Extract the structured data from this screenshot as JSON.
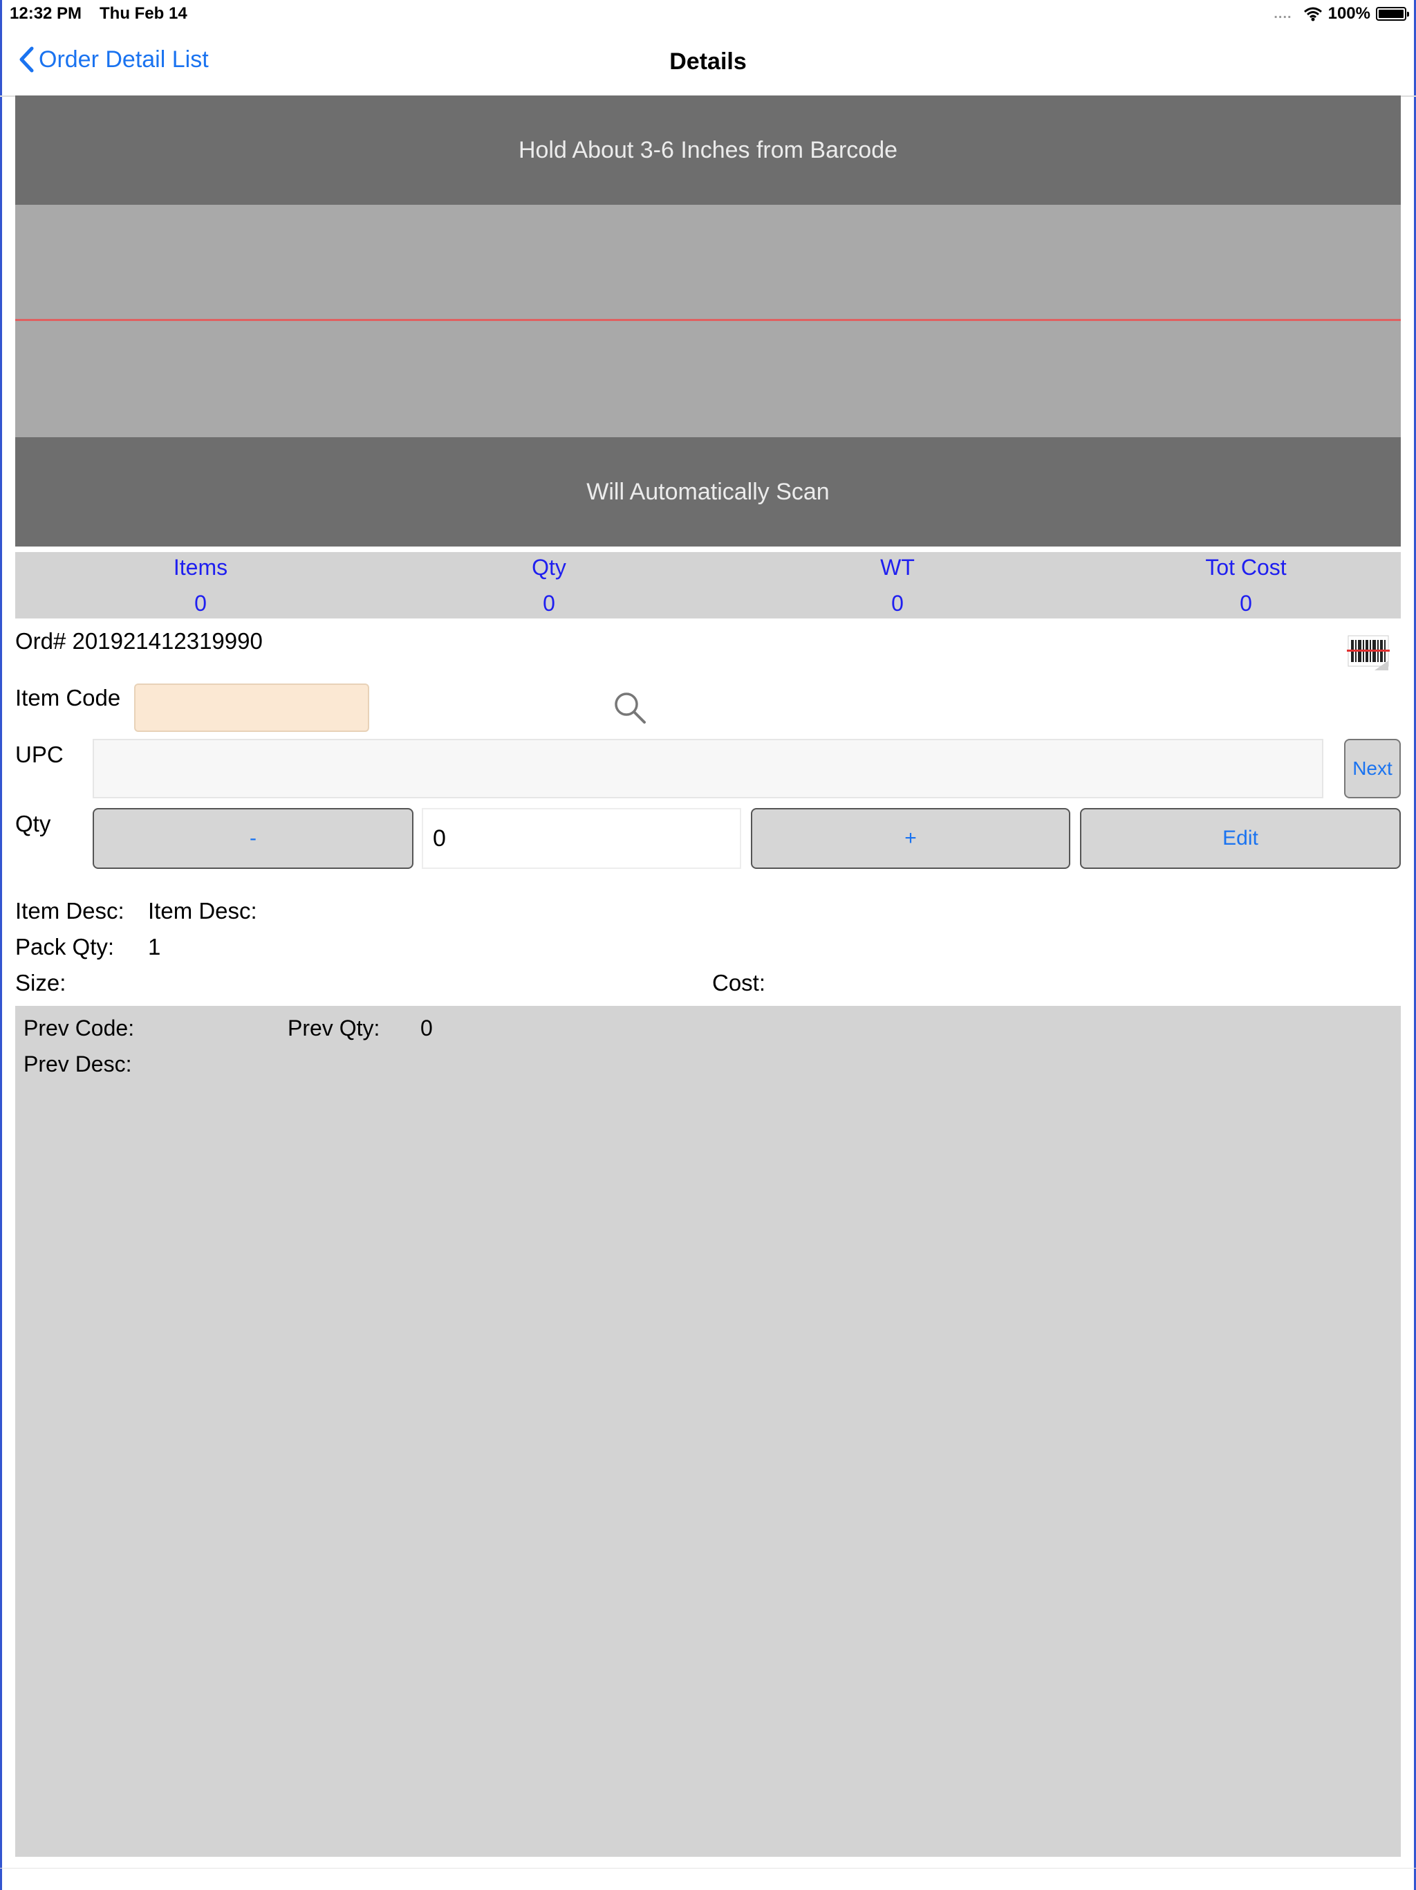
{
  "status_bar": {
    "time": "12:32 PM",
    "date": "Thu Feb 14",
    "signal": "....",
    "battery": "100%"
  },
  "nav": {
    "back_label": "Order Detail List",
    "title": "Details"
  },
  "scanner": {
    "top_text": "Hold About 3-6 Inches from Barcode",
    "bottom_text": "Will Automatically Scan"
  },
  "summary": {
    "columns": [
      {
        "label": "Items",
        "value": "0"
      },
      {
        "label": "Qty",
        "value": "0"
      },
      {
        "label": "WT",
        "value": "0"
      },
      {
        "label": "Tot Cost",
        "value": "0"
      }
    ]
  },
  "order": {
    "number_text": "Ord# 201921412319990"
  },
  "form": {
    "item_code_label": "Item Code",
    "item_code_value": "",
    "upc_label": "UPC",
    "upc_value": "",
    "next_label": "Next",
    "qty_label": "Qty",
    "minus_label": "-",
    "qty_value": "0",
    "plus_label": "+",
    "edit_label": "Edit"
  },
  "details": {
    "item_desc_label": "Item Desc:",
    "item_desc_value": "Item Desc:",
    "pack_qty_label": "Pack Qty:",
    "pack_qty_value": "1",
    "size_label": "Size:",
    "size_value": "",
    "cost_label": "Cost:",
    "cost_value": ""
  },
  "previous": {
    "code_label": "Prev Code:",
    "code_value": "",
    "qty_label": "Prev Qty:",
    "qty_value": "0",
    "desc_label": "Prev Desc:",
    "desc_value": ""
  },
  "icons": {
    "back": "chevron-left-icon",
    "wifi": "wifi-icon",
    "battery": "battery-icon",
    "search": "search-icon",
    "barcode": "barcode-icon"
  },
  "colors": {
    "link_blue": "#1a73f0",
    "summary_blue": "#1f1ff0",
    "scan_line": "#e06060",
    "item_code_bg": "#fbe8d3"
  }
}
